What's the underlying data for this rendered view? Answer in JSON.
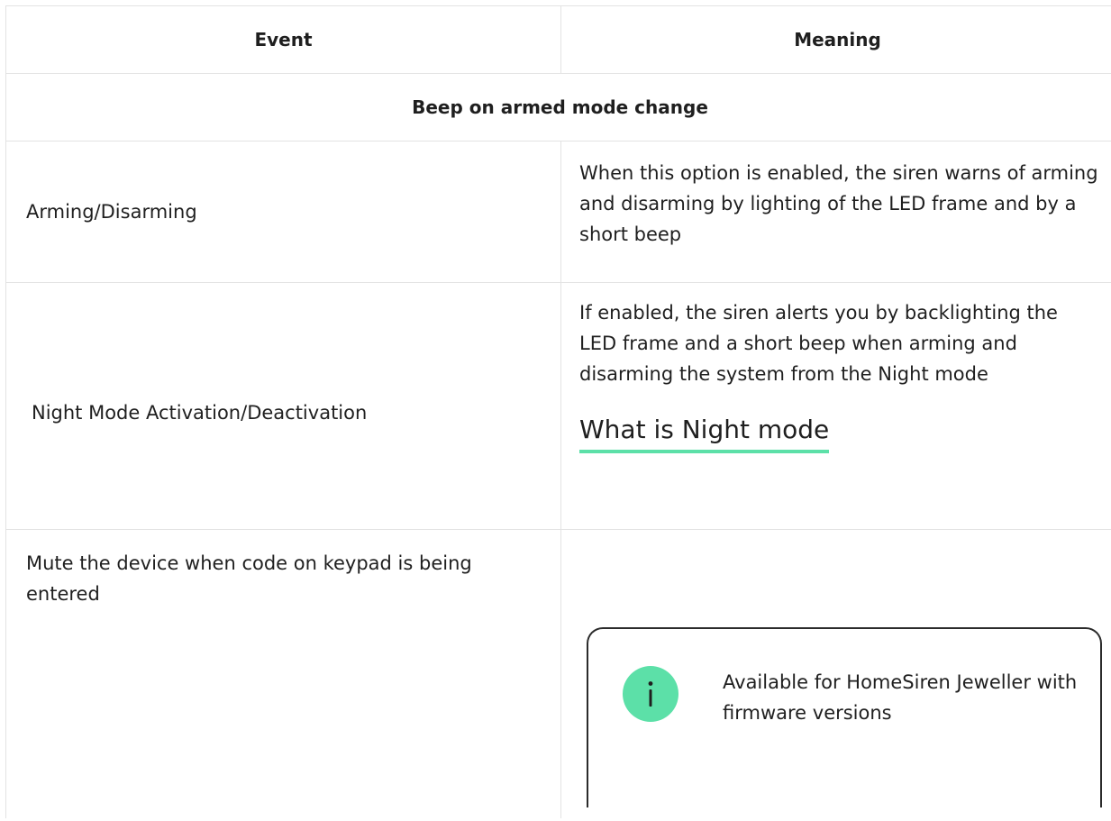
{
  "table": {
    "header": {
      "event": "Event",
      "meaning": "Meaning"
    },
    "section_title": "Beep on armed mode change",
    "rows": [
      {
        "event": "Arming/Disarming",
        "meaning": "When this option is enabled, the siren warns of arming and disarming by lighting of the LED frame and by a short beep"
      },
      {
        "event": "Night Mode Activation/Deactivation",
        "meaning": "If enabled, the siren alerts you by backlighting the LED frame and a short beep when arming and disarming the system from the Night mode",
        "link_text": "What is Night mode"
      },
      {
        "event": "Mute the device when code on keypad is being entered",
        "info_text": "Available for HomeSiren Jeweller with firmware versions"
      }
    ]
  },
  "colors": {
    "accent": "#5ce0a8",
    "border": "#e3e3e3",
    "text": "#1f1f1f"
  },
  "icons": {
    "info": "info-icon"
  }
}
